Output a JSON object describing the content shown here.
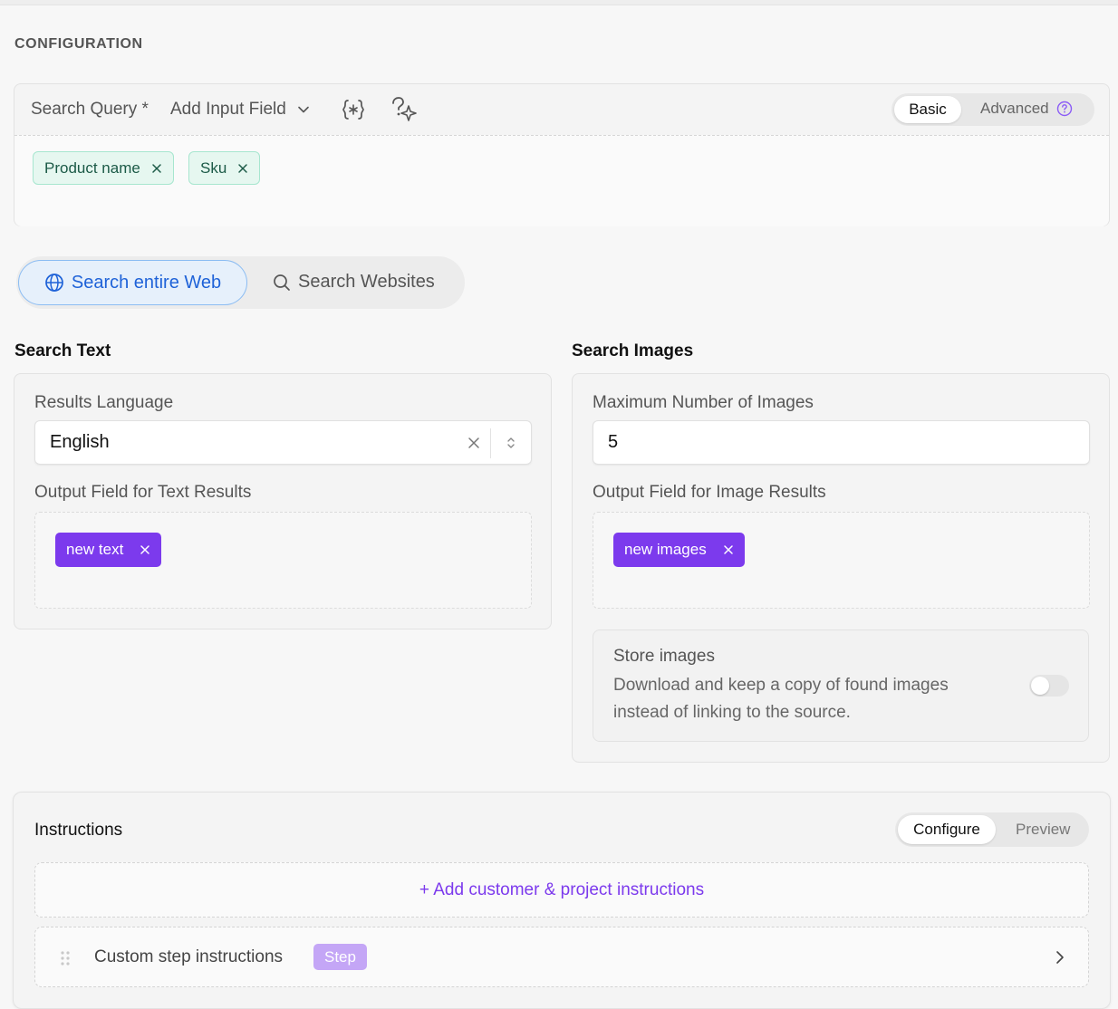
{
  "section_title": "CONFIGURATION",
  "query": {
    "label": "Search Query",
    "required_mark": "*",
    "add_input_label": "Add Input Field",
    "mode_basic": "Basic",
    "mode_advanced": "Advanced",
    "chips": [
      {
        "label": "Product name"
      },
      {
        "label": "Sku"
      }
    ]
  },
  "search_mode": {
    "web_label": "Search entire Web",
    "sites_label": "Search Websites",
    "selected": "web"
  },
  "search_text": {
    "title": "Search Text",
    "language_label": "Results Language",
    "language_value": "English",
    "output_label": "Output Field for Text Results",
    "output_chip": "new text"
  },
  "search_images": {
    "title": "Search Images",
    "max_label": "Maximum Number of Images",
    "max_value": "5",
    "output_label": "Output Field for Image Results",
    "output_chip": "new images",
    "store_title": "Store images",
    "store_desc_1": "Download and keep a copy of found images",
    "store_desc_2": "instead of linking to the source.",
    "store_enabled": false
  },
  "instructions": {
    "title": "Instructions",
    "tab_configure": "Configure",
    "tab_preview": "Preview",
    "add_label": "+ Add customer & project instructions",
    "step_label": "Custom step instructions",
    "step_badge": "Step"
  },
  "colors": {
    "accent_purple": "#7c3aed",
    "accent_blue": "#1e62d8",
    "chip_green_bg": "#e6f7f0"
  }
}
